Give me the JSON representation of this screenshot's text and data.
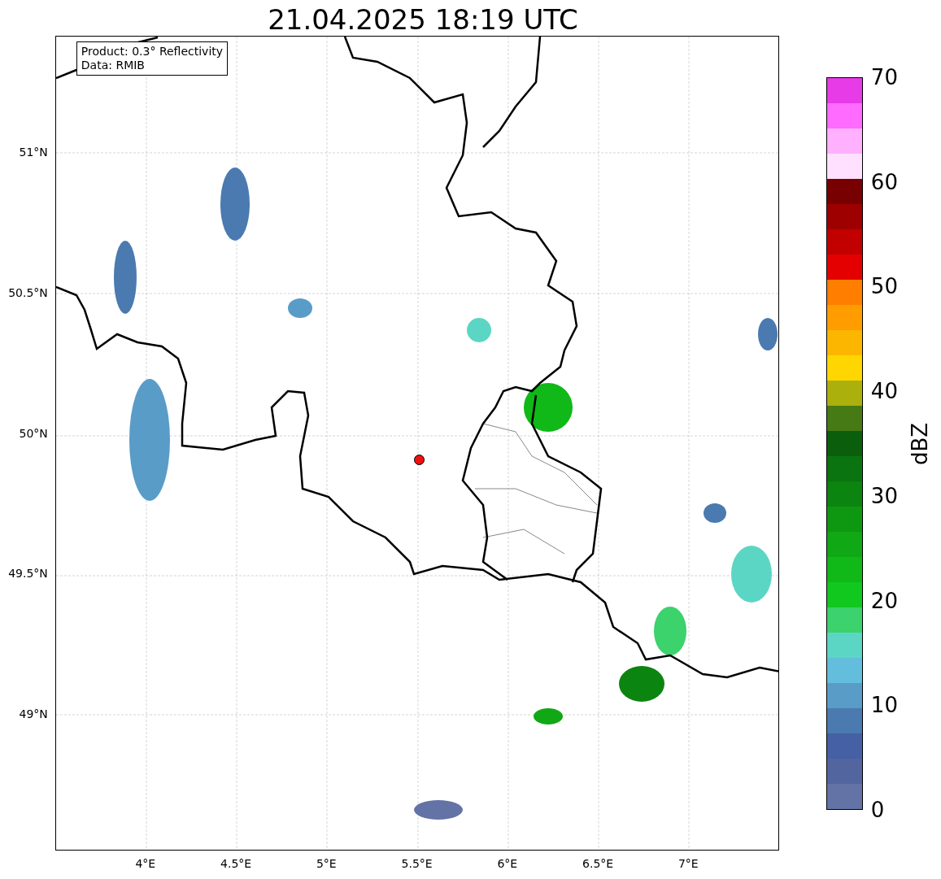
{
  "title": "21.04.2025 18:19 UTC",
  "legend": {
    "lines": [
      "Product: 0.3° Reflectivity",
      "Data: RMIB"
    ]
  },
  "map": {
    "y_ticks": [
      "51°N",
      "50.5°N",
      "50°N",
      "49.5°N",
      "49°N"
    ],
    "x_ticks": [
      "4°E",
      "4.5°E",
      "5°E",
      "5.5°E",
      "6°E",
      "6.5°E",
      "7°E"
    ]
  },
  "colorbar": {
    "label": "dBZ",
    "ticks": [
      "70",
      "60",
      "50",
      "40",
      "30",
      "20",
      "10",
      "0"
    ],
    "bands": [
      {
        "color": "#e73be8"
      },
      {
        "color": "#ff6aff"
      },
      {
        "color": "#ffb0ff"
      },
      {
        "color": "#ffe0ff"
      },
      {
        "color": "#780000"
      },
      {
        "color": "#9e0000"
      },
      {
        "color": "#c20000"
      },
      {
        "color": "#e40000"
      },
      {
        "color": "#ff7e00"
      },
      {
        "color": "#ff9c00"
      },
      {
        "color": "#fcb600"
      },
      {
        "color": "#ffd600"
      },
      {
        "color": "#acb00c"
      },
      {
        "color": "#467a14"
      },
      {
        "color": "#0a5e0c"
      },
      {
        "color": "#0a7410"
      },
      {
        "color": "#0c8410"
      },
      {
        "color": "#0e9812"
      },
      {
        "color": "#10a814"
      },
      {
        "color": "#10b818"
      },
      {
        "color": "#10c81e"
      },
      {
        "color": "#3cd26c"
      },
      {
        "color": "#5cd6c4"
      },
      {
        "color": "#62bedc"
      },
      {
        "color": "#5a9cc8"
      },
      {
        "color": "#4a7ab0"
      },
      {
        "color": "#4560a4"
      },
      {
        "color": "#52659e"
      },
      {
        "color": "#6473a6"
      }
    ]
  }
}
